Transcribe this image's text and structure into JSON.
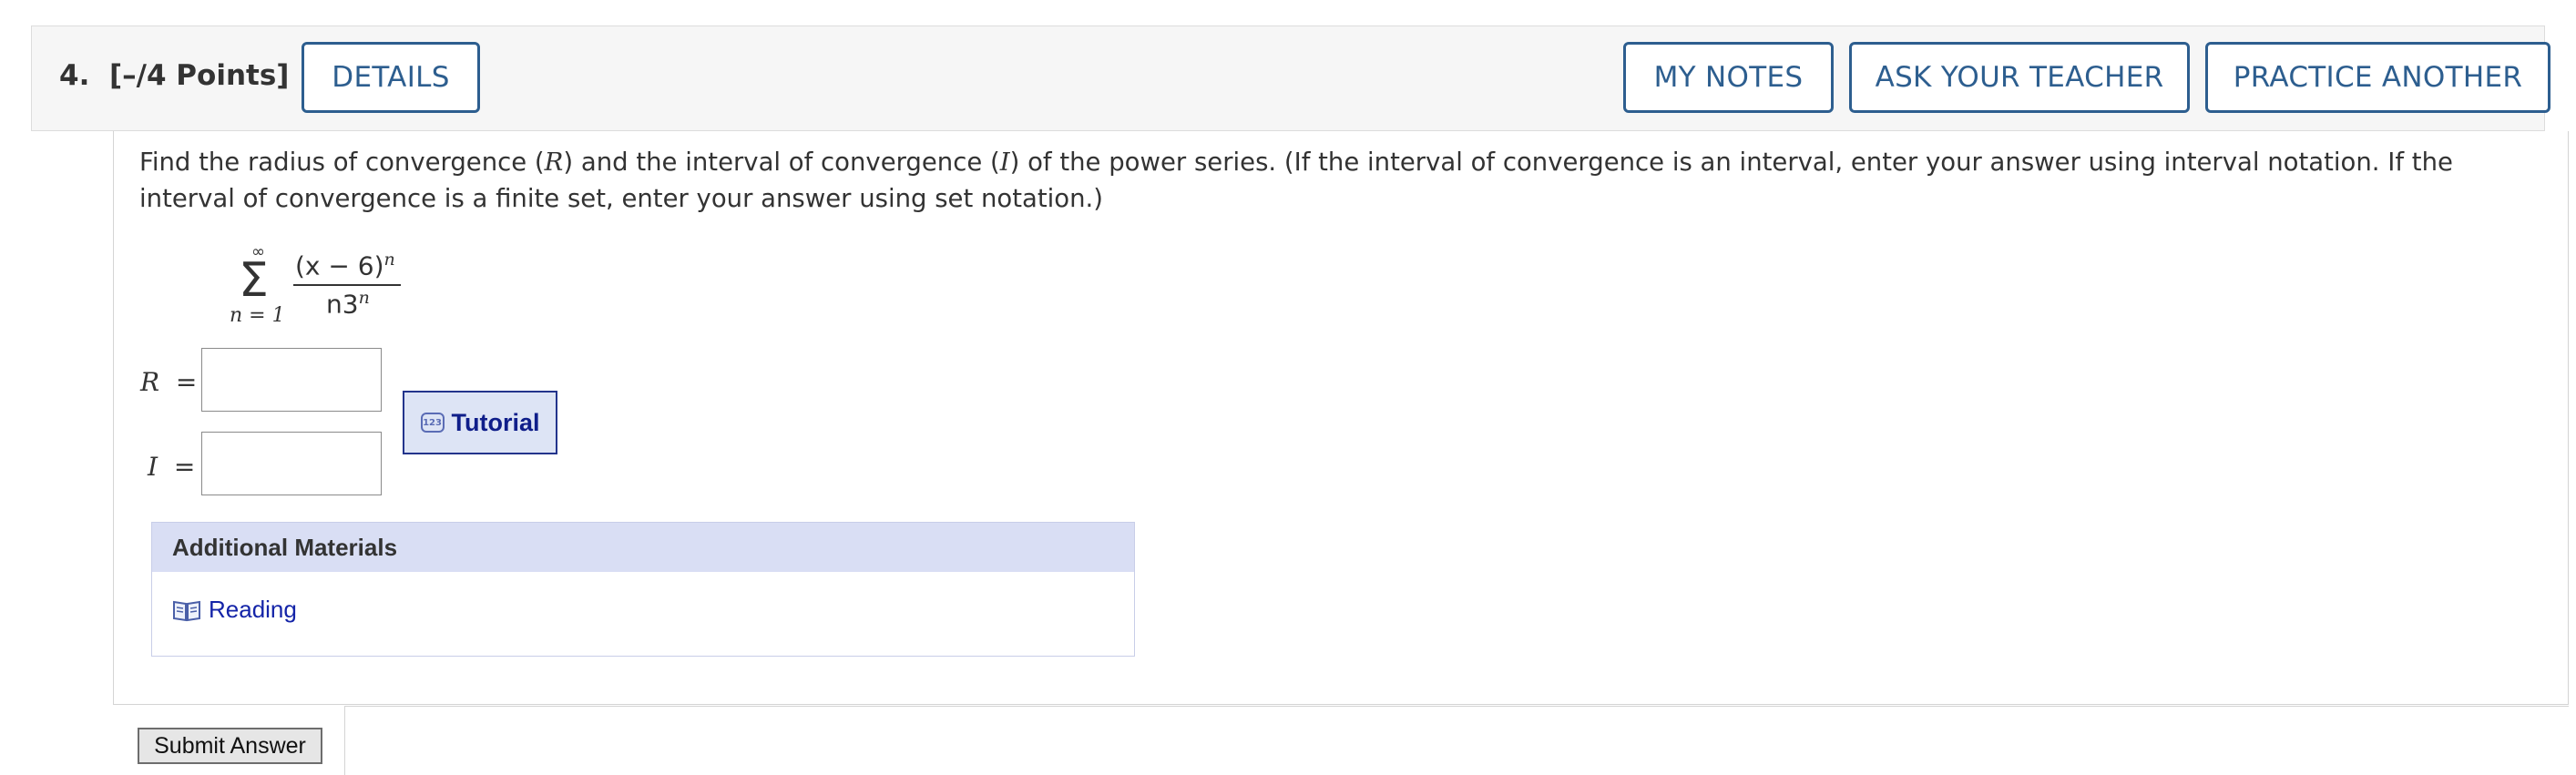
{
  "question": {
    "number_label": "4.",
    "points_label": "[–/4 Points]",
    "text_parts": [
      "Find the radius of convergence (",
      "R",
      ") and the interval of convergence (",
      "I",
      ") of the power series. (If the interval of convergence is an interval, enter your answer using interval notation. If the interval of convergence is a finite set, enter your answer using set notation.)"
    ]
  },
  "header_buttons": {
    "details": "DETAILS",
    "my_notes": "MY NOTES",
    "ask_teacher": "ASK YOUR TEACHER",
    "practice_another": "PRACTICE ANOTHER"
  },
  "series": {
    "sigma": "Σ",
    "upper": "∞",
    "lower": "n = 1",
    "numerator_base": "(x − 6)",
    "numerator_exp": "n",
    "denominator_base": "n3",
    "denominator_exp": "n"
  },
  "answers": {
    "r_label": "R",
    "i_label": "I",
    "equals": "=",
    "r_value": "",
    "i_value": ""
  },
  "tutorial": {
    "icon_text": "123",
    "label": "Tutorial"
  },
  "additional_materials": {
    "title": "Additional Materials",
    "items": [
      {
        "label": "Reading",
        "icon": "book-icon"
      }
    ]
  },
  "submit_label": "Submit Answer",
  "colors": {
    "button_blue": "#2d5e8f",
    "link_blue": "#1424a8",
    "panel_header_bg": "#d9def4",
    "tutorial_bg": "#dde4f5"
  }
}
